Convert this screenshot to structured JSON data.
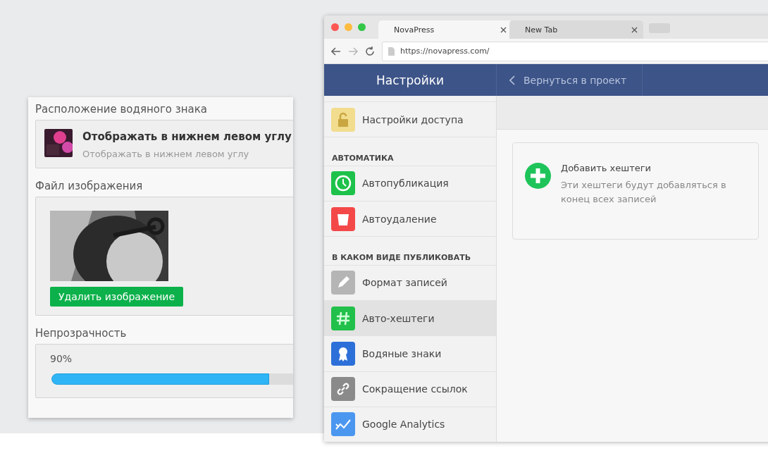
{
  "watermark_panel": {
    "sections": [
      {
        "kind": "option",
        "label": "Расположение водяного знака",
        "title": "Отображать в нижнем левом углу",
        "subtitle": "Отображать в нижнем левом углу"
      },
      {
        "label": "Файл изображения",
        "button": "Удалить изображение"
      },
      {
        "kind": "slider",
        "label": "Непрозрачность",
        "reading": "90%",
        "level": 0.9
      }
    ]
  },
  "browser": {
    "tabs": [
      {
        "label": "NovaPress",
        "selected": true
      },
      {
        "label": "New Tab",
        "selected": false
      }
    ],
    "url": "https://novapress.com/"
  },
  "app": {
    "header": {
      "title": "Настройки",
      "back": "Вернуться в проект"
    },
    "sidebar": {
      "items": [
        {
          "kind": "item",
          "label": "Настройки доступа",
          "color": "#f2dc8e",
          "selected": false
        },
        {
          "kind": "header",
          "label": "АВТОМАТИКА"
        },
        {
          "kind": "item",
          "label": "Автопубликация",
          "color": "#1ec24b",
          "selected": false
        },
        {
          "kind": "item",
          "label": "Автоудаление",
          "color": "#f44848",
          "selected": false
        },
        {
          "kind": "header",
          "label": "В КАКОМ ВИДЕ ПУБЛИКОВАТЬ"
        },
        {
          "kind": "item",
          "label": "Формат записей",
          "color": "#b5b5b5",
          "selected": false
        },
        {
          "kind": "item",
          "label": "Авто-хештеги",
          "color": "#21c04a",
          "selected": true
        },
        {
          "kind": "item",
          "label": "Водяные знаки",
          "color": "#2d6fd8",
          "selected": false
        },
        {
          "kind": "item",
          "label": "Сокращение ссылок",
          "color": "#8a8a8a",
          "selected": false
        },
        {
          "kind": "item",
          "label": "Google Analytics",
          "color": "#4b97f0",
          "selected": false
        }
      ]
    },
    "card": {
      "title": "Добавить хештеги",
      "text": "Эти хештеги будут добавляться в конец всех записей"
    }
  }
}
